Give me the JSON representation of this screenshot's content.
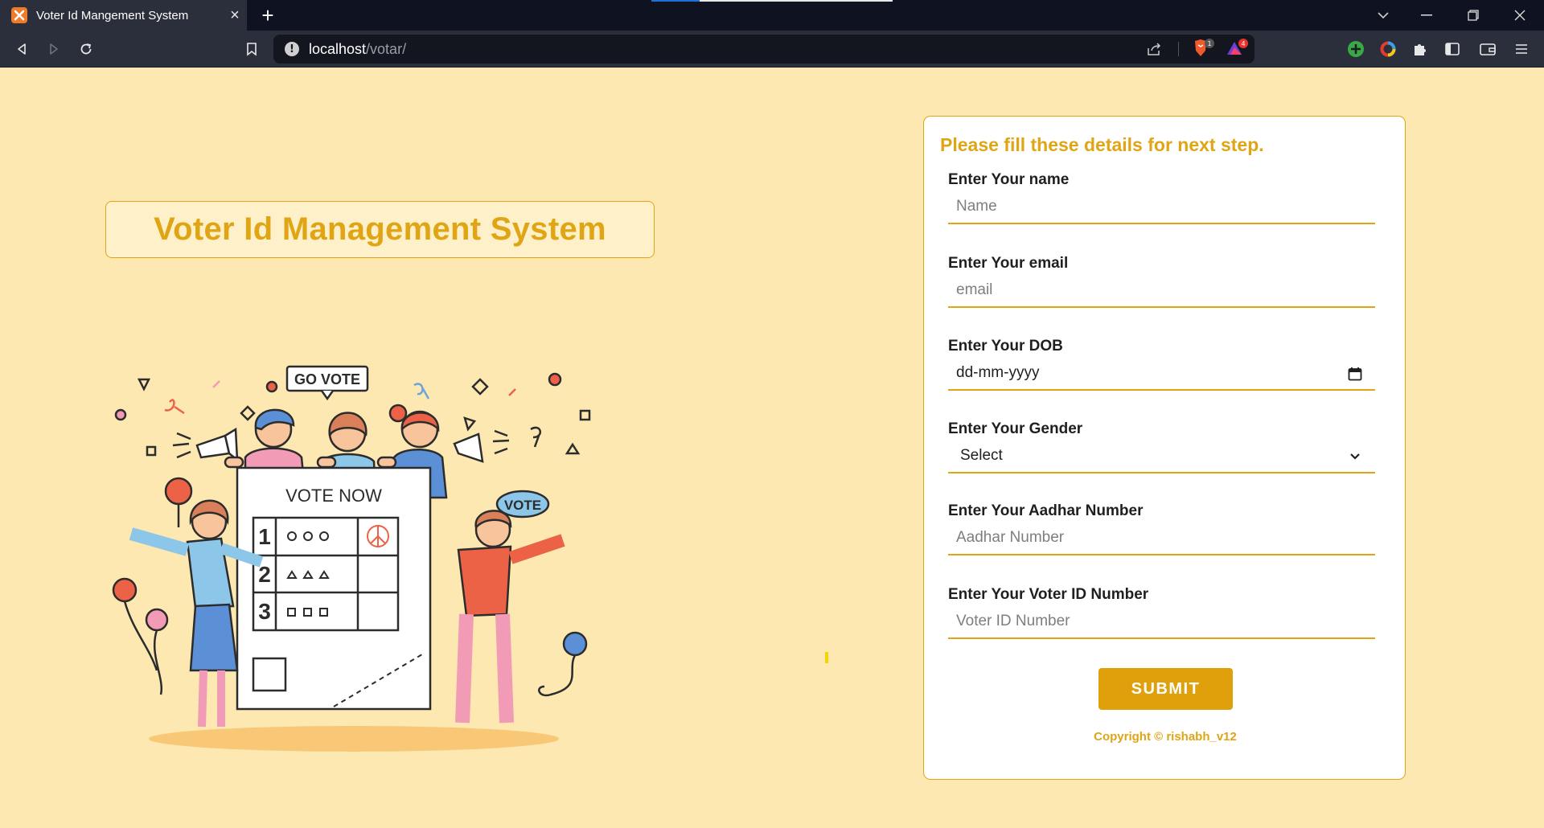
{
  "browser": {
    "tab_title": "Voter Id Mangement System",
    "new_tab_label": "+",
    "url_host": "localhost",
    "url_path": "/votar/",
    "extension_badges": [
      "1",
      "4"
    ]
  },
  "page": {
    "title": "Voter Id Management System",
    "illustration": {
      "top_sign": "GO VOTE",
      "ballot_heading": "VOTE NOW",
      "ballot_rows": [
        "1",
        "2",
        "3"
      ],
      "speech_bubble": "VOTE"
    }
  },
  "form": {
    "heading": "Please fill these details for next step.",
    "fields": [
      {
        "label": "Enter Your name",
        "placeholder": "Name"
      },
      {
        "label": "Enter Your email",
        "placeholder": "email"
      },
      {
        "label": "Enter Your DOB",
        "value": "dd-mm-yyyy"
      },
      {
        "label": "Enter Your Gender",
        "value": "Select"
      },
      {
        "label": "Enter Your Aadhar Number",
        "placeholder": "Aadhar Number"
      },
      {
        "label": "Enter Your Voter ID Number",
        "placeholder": "Voter ID Number"
      }
    ],
    "submit_label": "SUBMIT",
    "copyright": "Copyright © rishabh_v12"
  },
  "colors": {
    "accent": "#e0a515",
    "page_background": "#fde8b1",
    "submit_background": "#e0a00c"
  }
}
